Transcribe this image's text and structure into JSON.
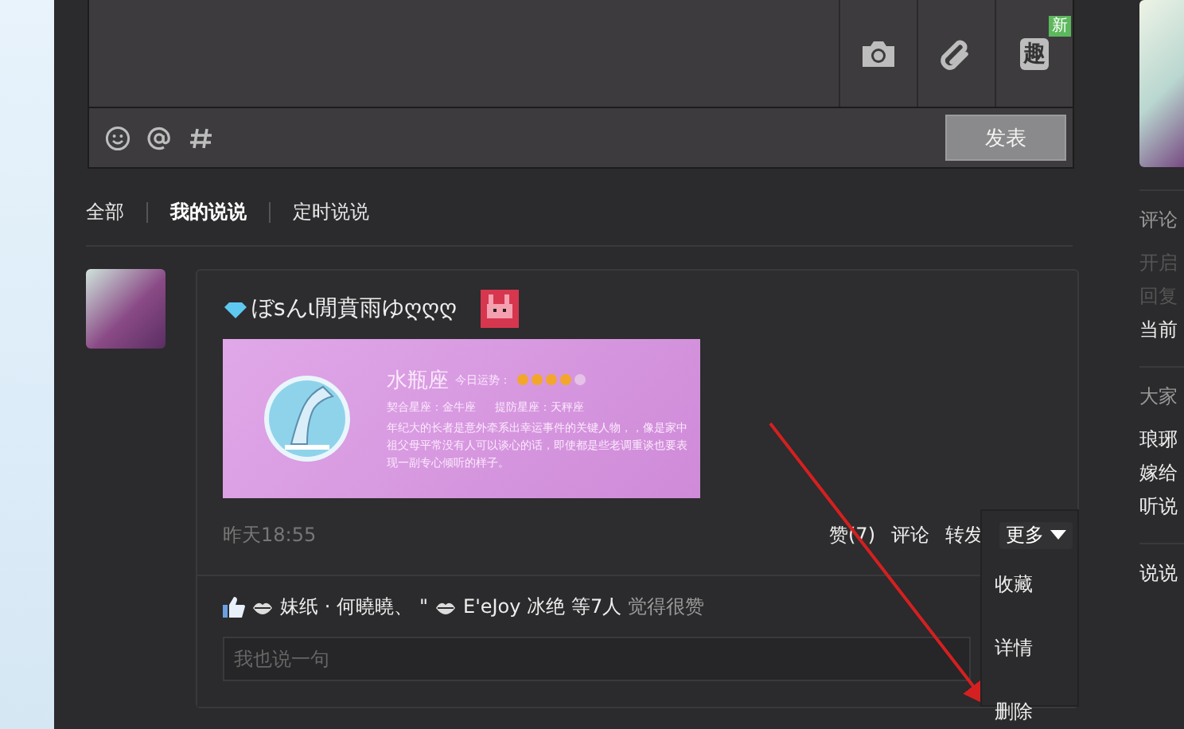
{
  "composer": {
    "tools": [
      {
        "kind": "camera"
      },
      {
        "kind": "link"
      },
      {
        "kind": "fun",
        "glyph": "趣",
        "badge": "新"
      }
    ],
    "insert": [
      {
        "kind": "emoji"
      },
      {
        "kind": "at"
      },
      {
        "kind": "topic"
      }
    ],
    "submit": "发表"
  },
  "filters": [
    {
      "label": "全部",
      "selected": false
    },
    {
      "label": "我的说说",
      "selected": true
    },
    {
      "label": "定时说说",
      "selected": false
    }
  ],
  "post": {
    "author": "ぼsんι閒賁雨ゆღღღ",
    "horoscope": {
      "sign": "水瓶座",
      "fortune_label": "今日运势：",
      "stars": 4,
      "match": "契合星座：金牛座",
      "beware": "提防星座：天秤座",
      "text": "年纪大的长者是意外牵系出幸运事件的关键人物，，像是家中祖父母平常没有人可以谈心的话，即使都是些老调重谈也要表现一副专心倾听的样子。"
    },
    "time": "昨天18:55",
    "actions": [
      "赞(7)",
      "评论",
      "转发"
    ],
    "more": {
      "label": "更多",
      "expanded": true,
      "items": [
        "收藏",
        "详情",
        "删除"
      ]
    },
    "likers": [
      "妹纸 · 何曉曉、",
      "\" ",
      "E'eJoy 冰绝"
    ],
    "like_count": "等7人",
    "like_suffix": "觉得很赞",
    "comment_placeholder": "我也说一句"
  },
  "sidebar": {
    "sections": [
      {
        "title": "评论",
        "lines": [
          "开启",
          "回复"
        ],
        "links": [
          "当前"
        ]
      },
      {
        "title": "大家",
        "links": [
          "琅琊",
          "嫁给",
          "听说"
        ]
      },
      {
        "links": [
          "说说"
        ]
      }
    ]
  }
}
